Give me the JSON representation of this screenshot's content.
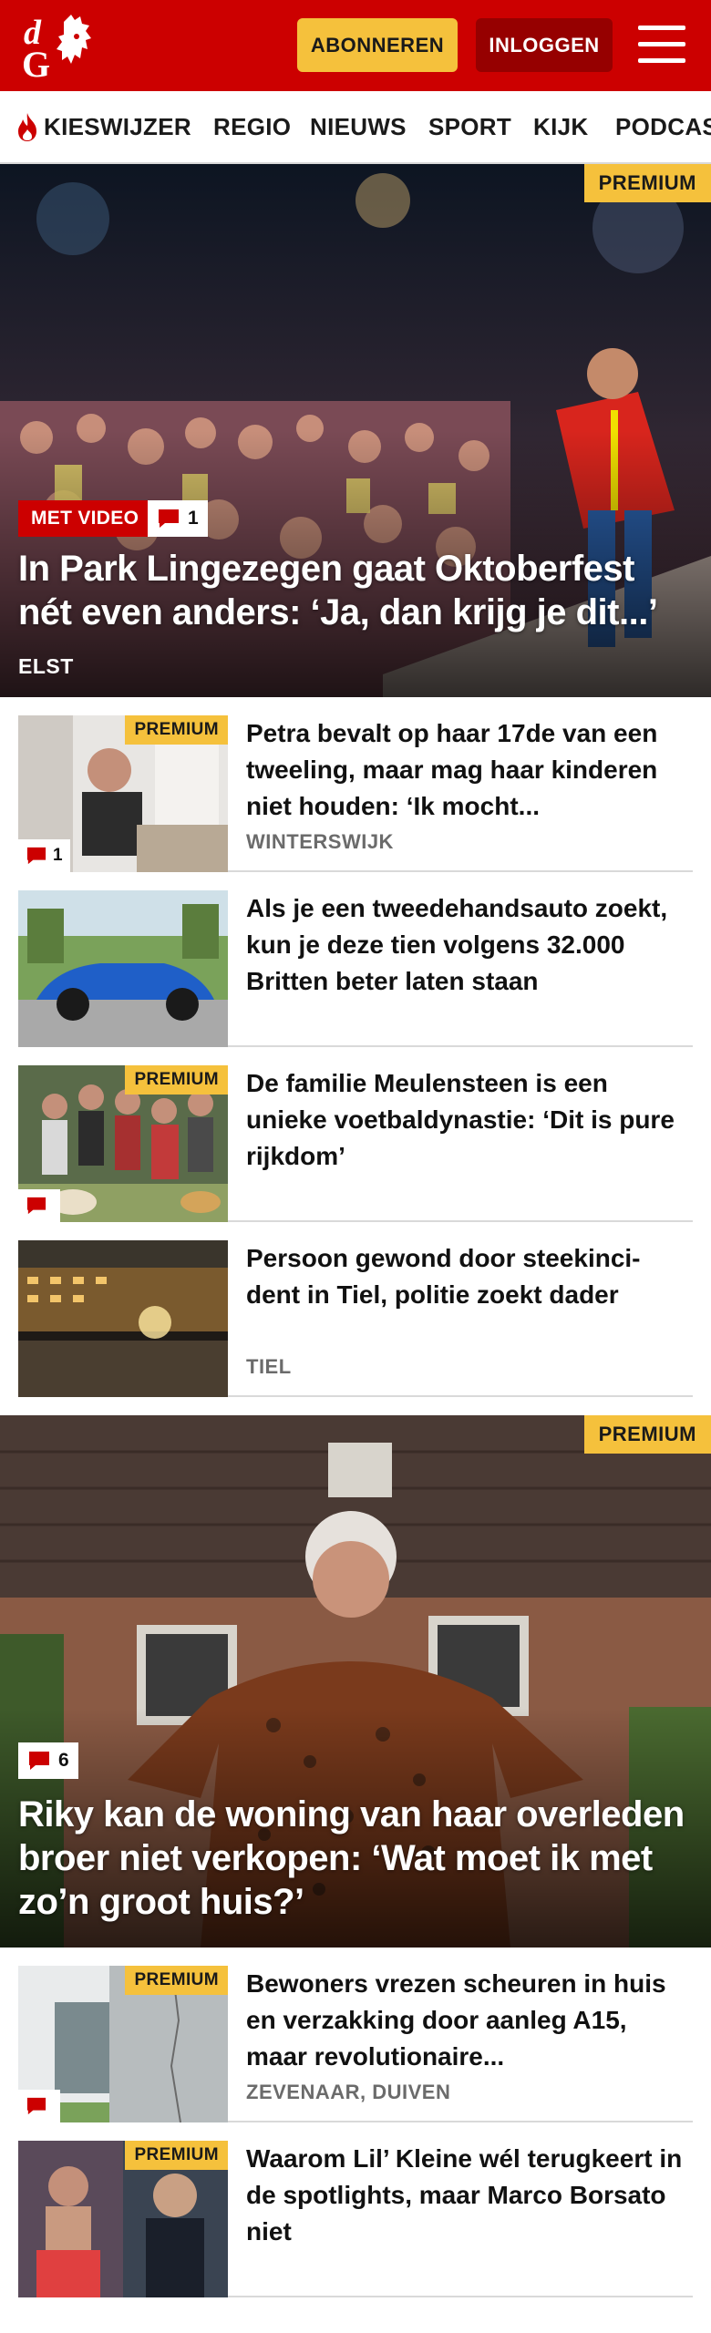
{
  "header": {
    "brand_letters": "dG",
    "subscribe_label": "ABONNEREN",
    "login_label": "INLOGGEN",
    "menu_icon": "hamburger-menu-icon",
    "brand_color": "#cc0000"
  },
  "nav": {
    "items": [
      {
        "label": "KIESWIJZER",
        "icon": "flame-icon"
      },
      {
        "label": "REGIO"
      },
      {
        "label": "NIEUWS"
      },
      {
        "label": "SPORT"
      },
      {
        "label": "KIJK"
      },
      {
        "label": "PODCAS"
      }
    ]
  },
  "hero1": {
    "badge": "PREMIUM",
    "video_label": "MET VIDEO",
    "comments": "1",
    "title": "In Park Lingezegen gaat Oktoberfest nét even anders: ‘Ja, dan krijg je dit...’",
    "location": "ELST"
  },
  "list1": [
    {
      "premium": "PREMIUM",
      "comments": "1",
      "title": "Petra bevalt op haar 17de van een tweeling, maar mag haar kinderen niet houden: ‘Ik mocht...",
      "location": "WINTERSWIJK"
    },
    {
      "title": "Als je een tweedehandsauto zoekt, kun je deze tien volgens 32.000 Britten beter laten staan"
    },
    {
      "premium": "PREMIUM",
      "title": "De familie Meulensteen is een unieke voetbaldynastie: ‘Dit is pure rijkdom’"
    },
    {
      "title": "Persoon gewond door steekinci-dent in Tiel, politie zoekt dader",
      "location": "TIEL"
    }
  ],
  "hero2": {
    "badge": "PREMIUM",
    "comments": "6",
    "title": "Riky kan de woning van haar overleden broer niet verkopen: ‘Wat moet ik met zo’n groot huis?’"
  },
  "list2": [
    {
      "premium": "PREMIUM",
      "title": "Bewoners vrezen scheuren in huis en verzakking door aanleg A15, maar revolutionaire...",
      "location": "ZEVENAAR, DUIVEN"
    },
    {
      "premium": "PREMIUM",
      "title": "Waarom Lil’ Kleine wél terugkeert in de spotlights, maar Marco Borsato niet"
    }
  ],
  "colors": {
    "premium": "#f5c13c",
    "login_button": "#960000",
    "divider": "#d9d9d9"
  }
}
